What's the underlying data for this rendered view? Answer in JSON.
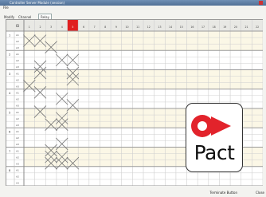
{
  "window": {
    "title": "Controller Server Module (session)"
  },
  "menu": {
    "label": "File",
    "row2": [
      "Modify",
      "Channel",
      "Relay"
    ]
  },
  "tabs": [
    {
      "label": "Modify"
    },
    {
      "label": "Channel"
    },
    {
      "label": "Relay"
    }
  ],
  "header": {
    "label": "ID",
    "columns": [
      "1",
      "2",
      "3",
      "4",
      "5",
      "6",
      "7",
      "8",
      "9",
      "10",
      "11",
      "12",
      "13",
      "14",
      "15",
      "16",
      "17",
      "18",
      "19",
      "20",
      "21",
      "22"
    ]
  },
  "groups": [
    {
      "id": "1",
      "rows": [
        "A1",
        "A2",
        "A3"
      ]
    },
    {
      "id": "2",
      "rows": [
        "A1",
        "A2",
        "A3"
      ]
    },
    {
      "id": "3",
      "rows": [
        "A1",
        "A2",
        "A3"
      ]
    },
    {
      "id": "4",
      "rows": [
        "A1",
        "A2",
        "A3"
      ]
    },
    {
      "id": "5",
      "rows": [
        "A1",
        "A2",
        "A3"
      ]
    },
    {
      "id": "6",
      "rows": [
        "A1",
        "A2",
        "A3"
      ]
    },
    {
      "id": "7",
      "rows": [
        "A1",
        "A2",
        "A3"
      ]
    },
    {
      "id": "8",
      "rows": [
        "A1",
        "A2",
        "A3"
      ]
    }
  ],
  "marks": [
    {
      "row": 1,
      "col": 1
    },
    {
      "row": 1,
      "col": 2
    },
    {
      "row": 2,
      "col": 3
    },
    {
      "row": 4,
      "col": 4
    },
    {
      "row": 4,
      "col": 5
    },
    {
      "row": 5,
      "col": 2
    },
    {
      "row": 6,
      "col": 2
    },
    {
      "row": 6,
      "col": 5
    },
    {
      "row": 7,
      "col": 5
    },
    {
      "row": 8,
      "col": 1
    },
    {
      "row": 9,
      "col": 2
    },
    {
      "row": 10,
      "col": 4
    },
    {
      "row": 11,
      "col": 5
    },
    {
      "row": 12,
      "col": 2
    },
    {
      "row": 13,
      "col": 4
    },
    {
      "row": 14,
      "col": 3
    },
    {
      "row": 14,
      "col": 4
    },
    {
      "row": 17,
      "col": 4
    },
    {
      "row": 18,
      "col": 3
    },
    {
      "row": 19,
      "col": 3
    },
    {
      "row": 19,
      "col": 4
    },
    {
      "row": 20,
      "col": 3
    },
    {
      "row": 20,
      "col": 4
    },
    {
      "row": 20,
      "col": 5
    }
  ],
  "highlight": {
    "column": 5,
    "color": "#e02020"
  },
  "logo": {
    "text": "Pact",
    "color": "#e2232b"
  },
  "status": {
    "left": "",
    "right1": "Terminate Button",
    "right2": "Close"
  },
  "colors": {
    "accent": "#e02020",
    "grid_line": "#cfcfcf",
    "grid_band": "#f7f3e0"
  }
}
